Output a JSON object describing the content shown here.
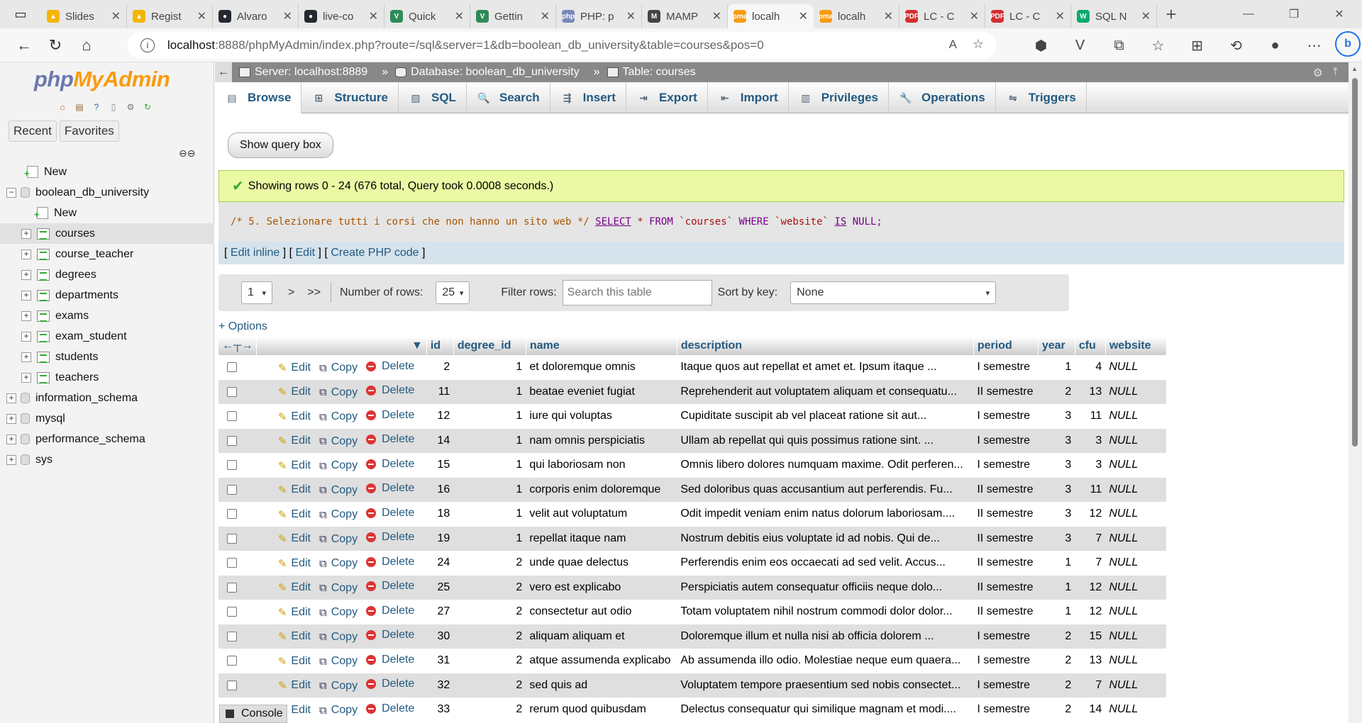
{
  "browser": {
    "tabs": [
      {
        "label": "Slides",
        "color": "#f4b400",
        "glyph": "▲"
      },
      {
        "label": "Regist",
        "color": "#f4b400",
        "glyph": "▲"
      },
      {
        "label": "Alvaro",
        "color": "#24292f",
        "glyph": "●"
      },
      {
        "label": "live-co",
        "color": "#24292f",
        "glyph": "●"
      },
      {
        "label": "Quick",
        "color": "#2e8b57",
        "glyph": "V"
      },
      {
        "label": "Gettin",
        "color": "#2e8b57",
        "glyph": "V"
      },
      {
        "label": "PHP: p",
        "color": "#7a86b8",
        "glyph": "php"
      },
      {
        "label": "MAMP",
        "color": "#444444",
        "glyph": "M"
      },
      {
        "label": "localh",
        "color": "#f89c0e",
        "glyph": "pma",
        "active": true
      },
      {
        "label": "localh",
        "color": "#f89c0e",
        "glyph": "pma"
      },
      {
        "label": "LC - C",
        "color": "#d32f2f",
        "glyph": "PDF"
      },
      {
        "label": "LC - C",
        "color": "#d32f2f",
        "glyph": "PDF"
      },
      {
        "label": "SQL N",
        "color": "#04aa6d",
        "glyph": "W"
      }
    ],
    "url_host": "localhost",
    "url_rest": ":8888/phpMyAdmin/index.php?route=/sql&server=1&db=boolean_db_university&table=courses&pos=0"
  },
  "left": {
    "logo_php": "php",
    "logo_ma": "MyAdmin",
    "tab_recent": "Recent",
    "tab_favorites": "Favorites",
    "tree": [
      {
        "label": "New",
        "level": 1,
        "kind": "new"
      },
      {
        "label": "boolean_db_university",
        "level": 0,
        "kind": "db",
        "exp": "−"
      },
      {
        "label": "New",
        "level": 2,
        "kind": "new"
      },
      {
        "label": "courses",
        "level": 1,
        "kind": "table",
        "exp": "+",
        "selected": true
      },
      {
        "label": "course_teacher",
        "level": 1,
        "kind": "table",
        "exp": "+"
      },
      {
        "label": "degrees",
        "level": 1,
        "kind": "table",
        "exp": "+"
      },
      {
        "label": "departments",
        "level": 1,
        "kind": "table",
        "exp": "+"
      },
      {
        "label": "exams",
        "level": 1,
        "kind": "table",
        "exp": "+"
      },
      {
        "label": "exam_student",
        "level": 1,
        "kind": "table",
        "exp": "+"
      },
      {
        "label": "students",
        "level": 1,
        "kind": "table",
        "exp": "+"
      },
      {
        "label": "teachers",
        "level": 1,
        "kind": "table",
        "exp": "+"
      },
      {
        "label": "information_schema",
        "level": 0,
        "kind": "db",
        "exp": "+"
      },
      {
        "label": "mysql",
        "level": 0,
        "kind": "db",
        "exp": "+"
      },
      {
        "label": "performance_schema",
        "level": 0,
        "kind": "db",
        "exp": "+"
      },
      {
        "label": "sys",
        "level": 0,
        "kind": "db",
        "exp": "+"
      }
    ]
  },
  "breadcrumb": {
    "server": "Server: localhost:8889",
    "database": "Database: boolean_db_university",
    "table": "Table: courses"
  },
  "menu": [
    "Browse",
    "Structure",
    "SQL",
    "Search",
    "Insert",
    "Export",
    "Import",
    "Privileges",
    "Operations",
    "Triggers"
  ],
  "query_box_button": "Show query box",
  "success_message": "Showing rows 0 - 24 (676 total, Query took 0.0008 seconds.)",
  "sql": {
    "comment": "/* 5. Selezionare tutti i corsi che non hanno un sito web */",
    "select": "SELECT",
    "star": "*",
    "from": "FROM",
    "table": "`courses`",
    "where": "WHERE",
    "column": "`website`",
    "is": "IS",
    "null": "NULL;"
  },
  "edit_links": {
    "edit_inline": "Edit inline",
    "edit": "Edit",
    "create_php": "Create PHP code"
  },
  "navigation": {
    "page": "1",
    "next": ">",
    "last": ">>",
    "rows_label": "Number of rows:",
    "rows_value": "25",
    "filter_label": "Filter rows:",
    "filter_placeholder": "Search this table",
    "sort_label": "Sort by key:",
    "sort_value": "None"
  },
  "options_link": "+ Options",
  "columns": [
    "id",
    "degree_id",
    "name",
    "description",
    "period",
    "year",
    "cfu",
    "website"
  ],
  "row_actions": {
    "edit": "Edit",
    "copy": "Copy",
    "delete": "Delete"
  },
  "rows": [
    {
      "id": "2",
      "degree_id": "1",
      "name": "et doloremque omnis",
      "description": "Itaque quos aut repellat et amet et. Ipsum itaque ...",
      "period": "I semestre",
      "year": "1",
      "cfu": "4",
      "website": "NULL"
    },
    {
      "id": "11",
      "degree_id": "1",
      "name": "beatae eveniet fugiat",
      "description": "Reprehenderit aut voluptatem aliquam et consequatu...",
      "period": "II semestre",
      "year": "2",
      "cfu": "13",
      "website": "NULL"
    },
    {
      "id": "12",
      "degree_id": "1",
      "name": "iure qui voluptas",
      "description": "Cupiditate suscipit ab vel placeat ratione sit aut...",
      "period": "I semestre",
      "year": "3",
      "cfu": "11",
      "website": "NULL"
    },
    {
      "id": "14",
      "degree_id": "1",
      "name": "nam omnis perspiciatis",
      "description": "Ullam ab repellat qui quis possimus ratione sint. ...",
      "period": "I semestre",
      "year": "3",
      "cfu": "3",
      "website": "NULL"
    },
    {
      "id": "15",
      "degree_id": "1",
      "name": "qui laboriosam non",
      "description": "Omnis libero dolores numquam maxime. Odit perferen...",
      "period": "I semestre",
      "year": "3",
      "cfu": "3",
      "website": "NULL"
    },
    {
      "id": "16",
      "degree_id": "1",
      "name": "corporis enim doloremque",
      "description": "Sed doloribus quas accusantium aut perferendis. Fu...",
      "period": "II semestre",
      "year": "3",
      "cfu": "11",
      "website": "NULL"
    },
    {
      "id": "18",
      "degree_id": "1",
      "name": "velit aut voluptatum",
      "description": "Odit impedit veniam enim natus dolorum laboriosam....",
      "period": "II semestre",
      "year": "3",
      "cfu": "12",
      "website": "NULL"
    },
    {
      "id": "19",
      "degree_id": "1",
      "name": "repellat itaque nam",
      "description": "Nostrum debitis eius voluptate id ad nobis. Qui de...",
      "period": "II semestre",
      "year": "3",
      "cfu": "7",
      "website": "NULL"
    },
    {
      "id": "24",
      "degree_id": "2",
      "name": "unde quae delectus",
      "description": "Perferendis enim eos occaecati ad sed velit. Accus...",
      "period": "II semestre",
      "year": "1",
      "cfu": "7",
      "website": "NULL"
    },
    {
      "id": "25",
      "degree_id": "2",
      "name": "vero est explicabo",
      "description": "Perspiciatis autem consequatur officiis neque dolo...",
      "period": "II semestre",
      "year": "1",
      "cfu": "12",
      "website": "NULL"
    },
    {
      "id": "27",
      "degree_id": "2",
      "name": "consectetur aut odio",
      "description": "Totam voluptatem nihil nostrum commodi dolor dolor...",
      "period": "II semestre",
      "year": "1",
      "cfu": "12",
      "website": "NULL"
    },
    {
      "id": "30",
      "degree_id": "2",
      "name": "aliquam aliquam et",
      "description": "Doloremque illum et nulla nisi ab officia dolorem ...",
      "period": "I semestre",
      "year": "2",
      "cfu": "15",
      "website": "NULL"
    },
    {
      "id": "31",
      "degree_id": "2",
      "name": "atque assumenda explicabo",
      "description": "Ab assumenda illo odio. Molestiae neque eum quaera...",
      "period": "I semestre",
      "year": "2",
      "cfu": "13",
      "website": "NULL"
    },
    {
      "id": "32",
      "degree_id": "2",
      "name": "sed quis ad",
      "description": "Voluptatem tempore praesentium sed nobis consectet...",
      "period": "I semestre",
      "year": "2",
      "cfu": "7",
      "website": "NULL"
    },
    {
      "id": "33",
      "degree_id": "2",
      "name": "rerum quod quibusdam",
      "description": "Delectus consequatur qui similique magnam et modi....",
      "period": "I semestre",
      "year": "2",
      "cfu": "14",
      "website": "NULL"
    }
  ],
  "console_label": "Console"
}
